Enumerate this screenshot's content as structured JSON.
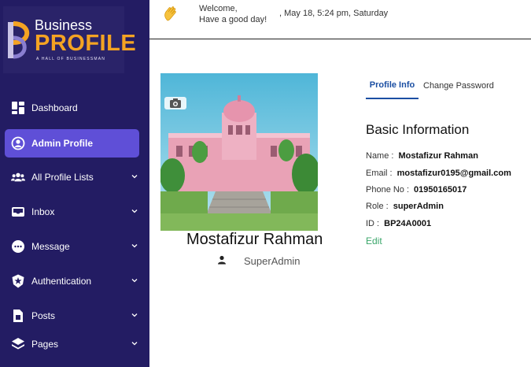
{
  "brand": {
    "line1": "Business",
    "line2": "PROFILE",
    "tagline": "A HALL OF BUSINESSMAN"
  },
  "sidebar": {
    "items": [
      {
        "label": "Dashboard",
        "icon": "dashboard-icon",
        "active": false,
        "expandable": false
      },
      {
        "label": "Admin Profile",
        "icon": "user-circle-icon",
        "active": true,
        "expandable": false
      },
      {
        "label": "All Profile Lists",
        "icon": "users-icon",
        "active": false,
        "expandable": true
      },
      {
        "label": "Inbox",
        "icon": "inbox-icon",
        "active": false,
        "expandable": true
      },
      {
        "label": "Message",
        "icon": "message-icon",
        "active": false,
        "expandable": true
      },
      {
        "label": "Authentication",
        "icon": "shield-icon",
        "active": false,
        "expandable": true
      },
      {
        "label": "Posts",
        "icon": "file-icon",
        "active": false,
        "expandable": true
      },
      {
        "label": "Pages",
        "icon": "layers-icon",
        "active": false,
        "expandable": true
      }
    ]
  },
  "header": {
    "welcome_line1": "Welcome,",
    "welcome_line2": "Have a good day!",
    "datetime": ", May 18, 5:24 pm, Saturday",
    "wave_icon": "waving-hand-icon"
  },
  "profile": {
    "name": "Mostafizur Rahman",
    "role": "SuperAdmin",
    "camera_icon": "camera-icon",
    "role_icon": "user-icon"
  },
  "tabs": {
    "active": "Profile Info",
    "inactive": "Change Password"
  },
  "basic_info": {
    "title": "Basic Information",
    "rows": [
      {
        "label": "Name :",
        "value": "Mostafizur Rahman"
      },
      {
        "label": "Email :",
        "value": "mostafizur0195@gmail.com"
      },
      {
        "label": "Phone No :",
        "value": "01950165017"
      },
      {
        "label": "Role :",
        "value": "superAdmin"
      },
      {
        "label": "ID :",
        "value": "BP24A0001"
      }
    ],
    "edit_label": "Edit"
  },
  "colors": {
    "sidebar_bg": "#231c63",
    "active_item": "#5f4fd7",
    "brand_accent": "#f4a323",
    "tab_accent": "#1b4fa3",
    "edit_link": "#3aa66a"
  }
}
